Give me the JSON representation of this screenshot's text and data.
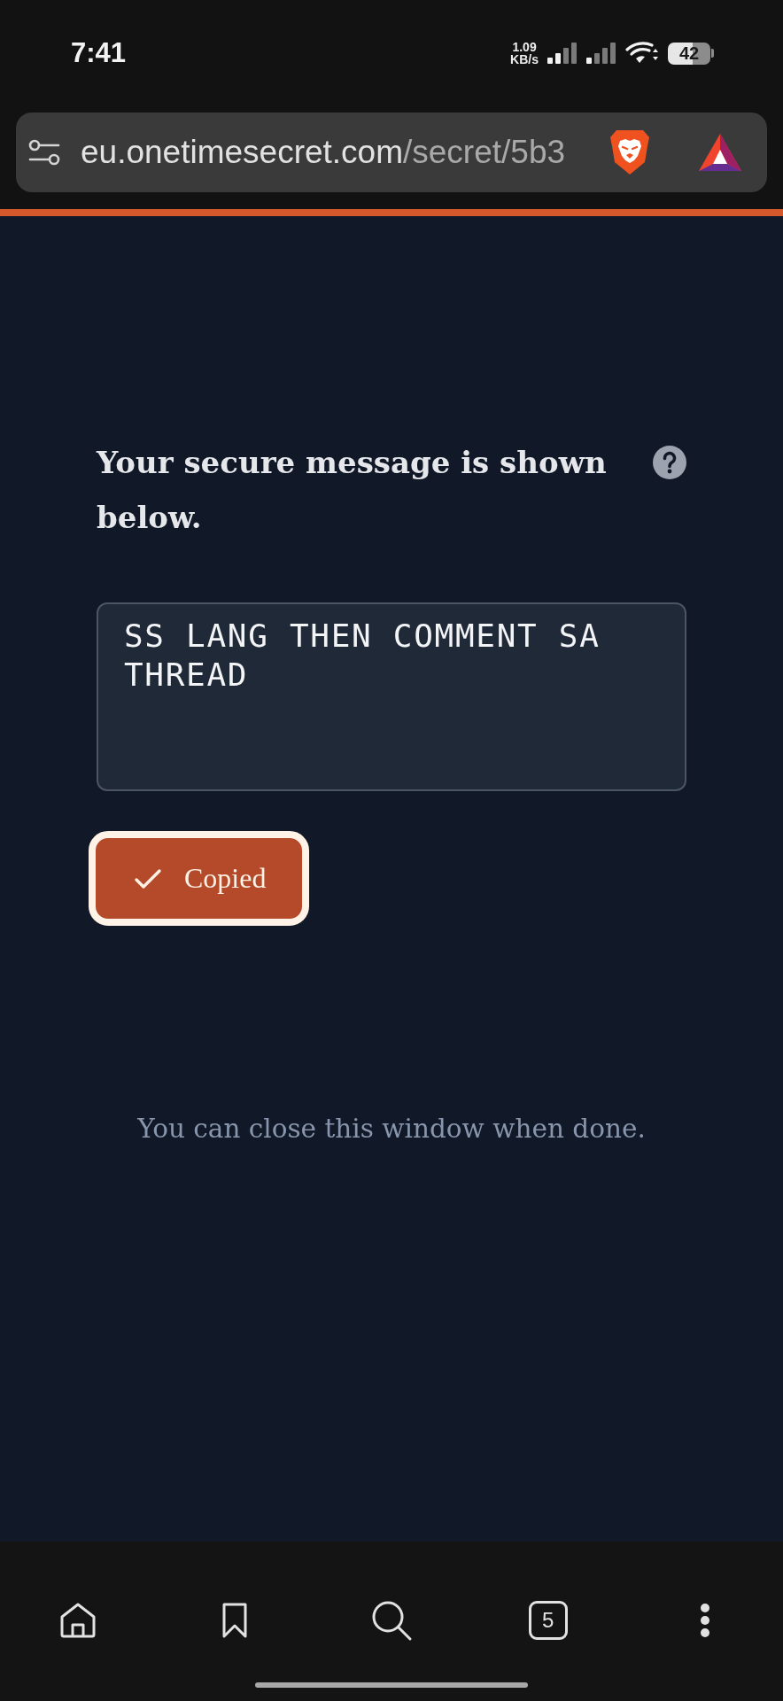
{
  "status_bar": {
    "time": "7:41",
    "net_speed": {
      "value": "1.09",
      "unit": "KB/s"
    },
    "battery": "42"
  },
  "browser_bar": {
    "url_domain": "eu.onetimesecret.com",
    "url_path": "/secret/5b3"
  },
  "page": {
    "heading": "Your secure message is shown below.",
    "message": {
      "value": "SS LANG THEN COMMENT SA THREAD"
    },
    "copy_button": {
      "label": "Copied",
      "focused": true
    },
    "footer_note": "You can close this window when done."
  },
  "bottom_nav": {
    "items": [
      {
        "kind": "home"
      },
      {
        "kind": "bookmark"
      },
      {
        "kind": "search"
      },
      {
        "kind": "tabs",
        "count": "5"
      },
      {
        "kind": "menu"
      }
    ]
  }
}
